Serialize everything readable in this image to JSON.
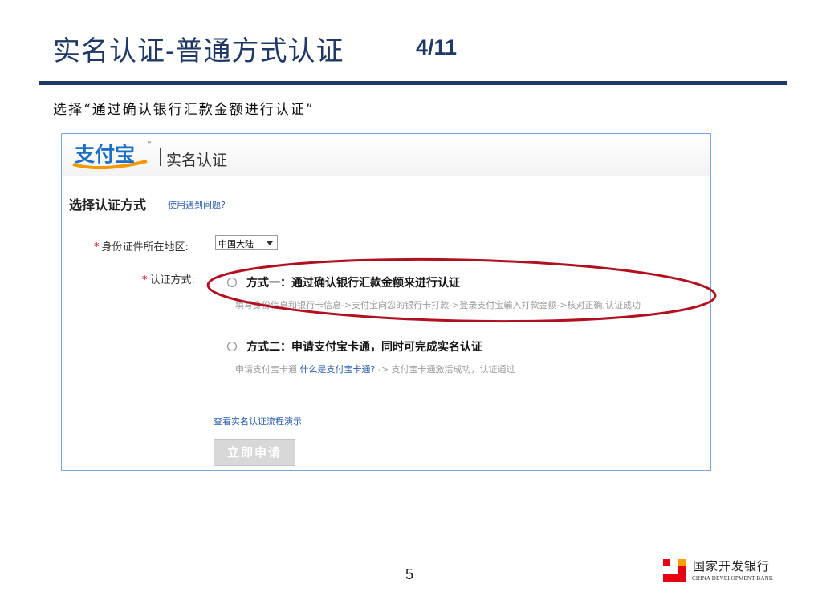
{
  "slide": {
    "title": "实名认证-普通方式认证",
    "page_indicator": "4/11",
    "instruction": "选择“通过确认银行汇款金额进行认证”",
    "page_number": "5"
  },
  "colors": {
    "title_blue": "#1f3864",
    "frame_border": "#7aa7d8",
    "link_blue": "#2a5db0",
    "highlight_red": "#b01020",
    "required_red": "#e00000",
    "cdb_red": "#e60012"
  },
  "app": {
    "logo_text": "支付宝",
    "header_title": "实名认证",
    "section_title": "选择认证方式",
    "help_link": "使用遇到问题?",
    "region": {
      "required_mark": "*",
      "label": "身份证件所在地区:",
      "selected": "中国大陆"
    },
    "method": {
      "required_mark": "*",
      "label": "认证方式:",
      "options": [
        {
          "title": "方式一：通过确认银行汇款金额来进行认证",
          "description": "填写身份信息和银行卡信息->支付宝向您的银行卡打款->登录支付宝输入打款金额->核对正确,认证成功"
        },
        {
          "title": "方式二：申请支付宝卡通，同时可完成实名认证",
          "desc_prefix": "申请支付宝卡通",
          "desc_link": "什么是支付宝卡通?",
          "desc_suffix": "-> 支付宝卡通激活成功，认证通过"
        }
      ]
    },
    "process_link": "查看实名认证流程演示",
    "apply_button": "立即申请"
  },
  "footer": {
    "bank_name_cn": "国家开发银行",
    "bank_name_en": "CHINA DEVELOPMENT BANK"
  }
}
